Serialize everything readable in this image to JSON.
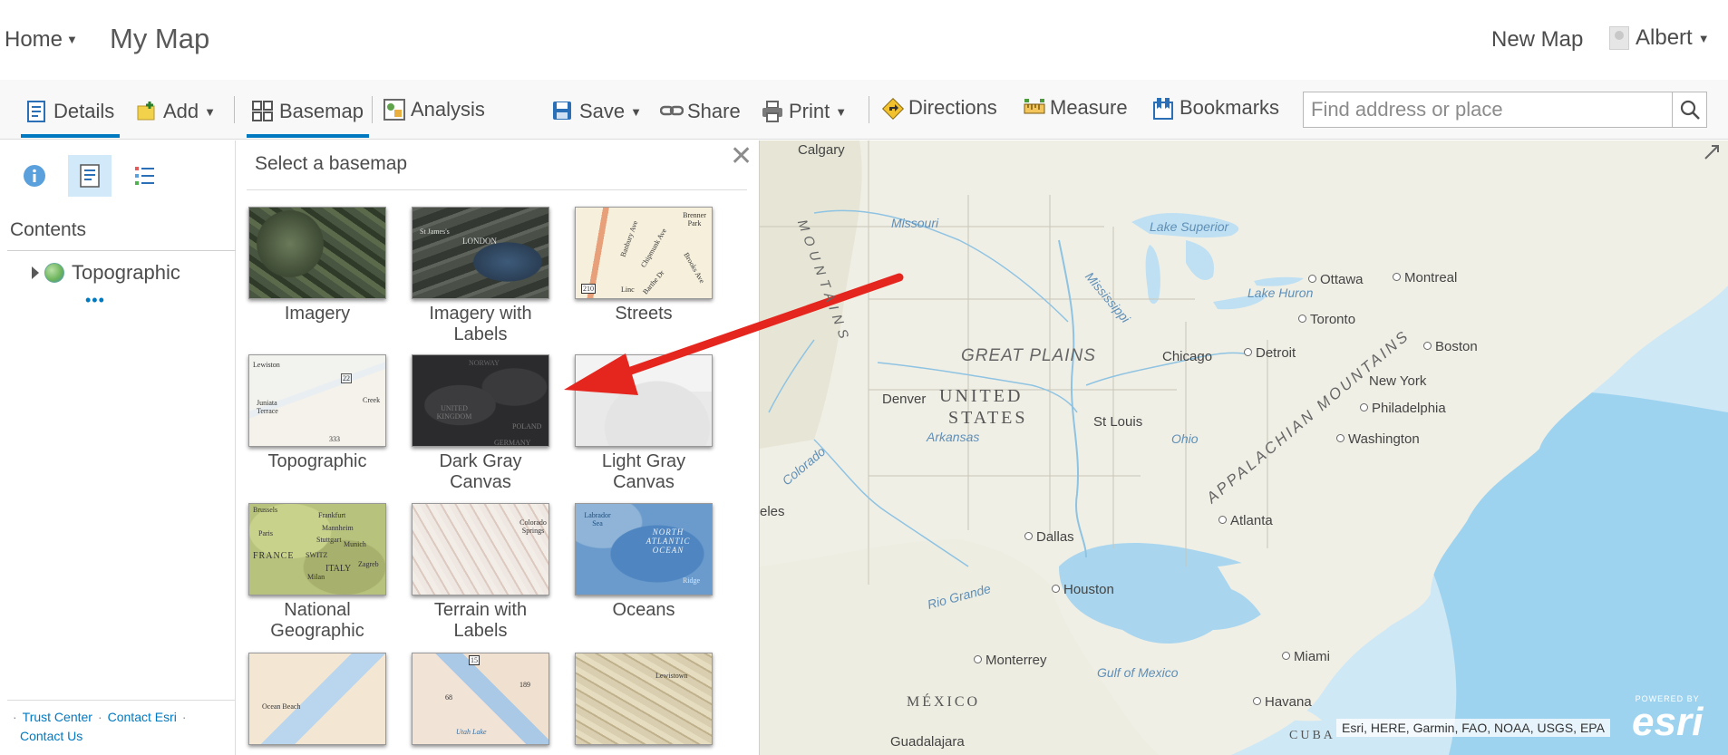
{
  "header": {
    "home_label": "Home",
    "map_title": "My Map",
    "new_map_label": "New Map",
    "user_name": "Albert"
  },
  "toolbar": {
    "details": "Details",
    "add": "Add",
    "basemap": "Basemap",
    "analysis": "Analysis",
    "save": "Save",
    "share": "Share",
    "print": "Print",
    "directions": "Directions",
    "measure": "Measure",
    "bookmarks": "Bookmarks",
    "search_placeholder": "Find address or place"
  },
  "left_pane": {
    "contents_title": "Contents",
    "layer_name": "Topographic",
    "more_glyph": "•••",
    "footer": {
      "trust_center": "Trust Center",
      "contact_esri": "Contact Esri",
      "contact_us": "Contact Us"
    }
  },
  "gallery": {
    "title": "Select a basemap",
    "close_glyph": "✕",
    "tiles": [
      {
        "label": "Imagery"
      },
      {
        "label": "Imagery with Labels"
      },
      {
        "label": "Streets"
      },
      {
        "label": "Topographic"
      },
      {
        "label": "Dark Gray Canvas"
      },
      {
        "label": "Light Gray Canvas"
      },
      {
        "label": "National Geographic"
      },
      {
        "label": "Terrain with Labels"
      },
      {
        "label": "Oceans"
      }
    ],
    "thumb_text": {
      "london": "LONDON",
      "james": "St James's",
      "brenner": "Brenner Park",
      "banbury": "Banbury Ave",
      "chipmunk": "Chipmunk Ave",
      "barthe": "Barthe Dr",
      "brooks": "Brooks Ave",
      "lincoln": "Linc",
      "hwy": "210",
      "lewiston": "Lewiston",
      "juniata": "Juniata Terrace",
      "creek": "Creek",
      "r22": "22",
      "r333": "333",
      "norway": "NORWAY",
      "uk": "UNITED KINGDOM",
      "poland": "POLAND",
      "germany": "GERMANY",
      "brussels": "Brussels",
      "frankfurt": "Frankfurt",
      "mannheim": "Mannheim",
      "stuttgart": "Stuttgart",
      "munich": "Munich",
      "paris": "Paris",
      "france": "FRANCE",
      "switz": "SWITZ",
      "italy": "ITALY",
      "zagreb": "Zagreb",
      "milan": "Milan",
      "colorado_springs": "Colorado Springs",
      "north_atlantic": "NORTH ATLANTIC OCEAN",
      "labrador": "Labrador Sea",
      "ridge": "Ridge",
      "ocean_beach": "Ocean Beach",
      "utah_lake": "Utah Lake",
      "lewistown": "Lewistown",
      "r68": "68",
      "i15": "15",
      "r189": "189"
    }
  },
  "map": {
    "labels": {
      "calgary": "Calgary",
      "missouri": "Missouri",
      "lake_superior": "Lake Superior",
      "ottawa": "Ottawa",
      "montreal": "Montreal",
      "lake_huron": "Lake Huron",
      "mississippi": "Mississippi",
      "toronto": "Toronto",
      "great_plains": "GREAT PLAINS",
      "chicago": "Chicago",
      "detroit": "Detroit",
      "boston": "Boston",
      "denver": "Denver",
      "united": "UNITED",
      "states": "STATES",
      "new_york": "New York",
      "philadelphia": "Philadelphia",
      "st_louis": "St Louis",
      "arkansas": "Arkansas",
      "ohio": "Ohio",
      "washington": "Washington",
      "colorado": "Colorado",
      "appalachian": "APPALACHIAN MOUNTAINS",
      "mountains_left": "M O U N T A I N S",
      "atlanta": "Atlanta",
      "eles": "eles",
      "dallas": "Dallas",
      "rio_grande": "Rio Grande",
      "houston": "Houston",
      "monterrey": "Monterrey",
      "gulf_of_mexico": "Gulf of Mexico",
      "miami": "Miami",
      "mexico": "MÉXICO",
      "havana": "Havana",
      "guadalajara": "Guadalajara",
      "cuba": "CUBA"
    },
    "attribution": "Esri, HERE, Garmin, FAO, NOAA, USGS, EPA",
    "powered_by": "POWERED BY",
    "esri_logo": "esri"
  },
  "colors": {
    "accent": "#0079c1",
    "arrow": "#e5261f",
    "land": "#f0efe6",
    "water": "#cfe8f5"
  }
}
